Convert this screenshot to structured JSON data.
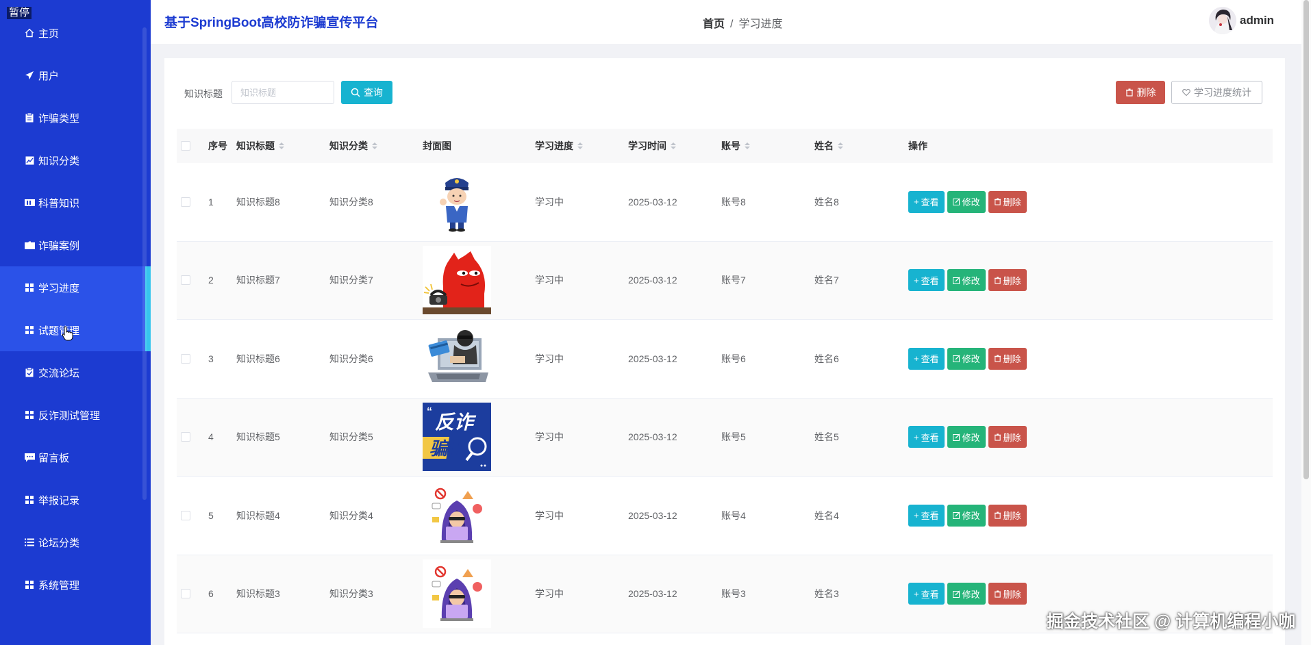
{
  "pause_label": "暂停",
  "header": {
    "title": "基于SpringBoot高校防诈骗宣传平台",
    "breadcrumb_home": "首页",
    "breadcrumb_sep": "/",
    "breadcrumb_current": "学习进度",
    "username": "admin"
  },
  "sidebar": {
    "items": [
      {
        "label": "主页",
        "icon": "home-icon"
      },
      {
        "label": "用户",
        "icon": "paper-plane-icon"
      },
      {
        "label": "诈骗类型",
        "icon": "clipboard-icon"
      },
      {
        "label": "知识分类",
        "icon": "chart-icon"
      },
      {
        "label": "科普知识",
        "icon": "book-icon"
      },
      {
        "label": "诈骗案例",
        "icon": "folder-icon"
      },
      {
        "label": "学习进度",
        "icon": "grid-icon"
      },
      {
        "label": "试题管理",
        "icon": "grid-icon"
      },
      {
        "label": "交流论坛",
        "icon": "clipboard-check-icon"
      },
      {
        "label": "反诈测试管理",
        "icon": "grid-icon"
      },
      {
        "label": "留言板",
        "icon": "message-icon"
      },
      {
        "label": "举报记录",
        "icon": "grid-icon"
      },
      {
        "label": "论坛分类",
        "icon": "list-icon"
      },
      {
        "label": "系统管理",
        "icon": "grid-icon"
      }
    ],
    "active_index": 6,
    "hover_index": 7
  },
  "filter": {
    "label": "知识标题",
    "placeholder": "知识标题",
    "search_label": "查询"
  },
  "toolbar": {
    "delete_label": "删除",
    "stats_label": "学习进度统计"
  },
  "table": {
    "columns": [
      "序号",
      "知识标题",
      "知识分类",
      "封面图",
      "学习进度",
      "学习时间",
      "账号",
      "姓名",
      "操作"
    ],
    "rows": [
      {
        "index": "1",
        "title": "知识标题8",
        "category": "知识分类8",
        "cover": "police-cover",
        "progress": "学习中",
        "time": "2025-03-12",
        "account": "账号8",
        "name": "姓名8"
      },
      {
        "index": "2",
        "title": "知识标题7",
        "category": "知识分类7",
        "cover": "red-monster-cover",
        "progress": "学习中",
        "time": "2025-03-12",
        "account": "账号7",
        "name": "姓名7"
      },
      {
        "index": "3",
        "title": "知识标题6",
        "category": "知识分类6",
        "cover": "laptop-thief-cover",
        "progress": "学习中",
        "time": "2025-03-12",
        "account": "账号6",
        "name": "姓名6"
      },
      {
        "index": "4",
        "title": "知识标题5",
        "category": "知识分类5",
        "cover": "anti-fraud-poster-cover",
        "progress": "学习中",
        "time": "2025-03-12",
        "account": "账号5",
        "name": "姓名5"
      },
      {
        "index": "5",
        "title": "知识标题4",
        "category": "知识分类4",
        "cover": "hooded-hacker-cover",
        "progress": "学习中",
        "time": "2025-03-12",
        "account": "账号4",
        "name": "姓名4"
      },
      {
        "index": "6",
        "title": "知识标题3",
        "category": "知识分类3",
        "cover": "hooded-hacker-cover",
        "progress": "学习中",
        "time": "2025-03-12",
        "account": "账号3",
        "name": "姓名3"
      }
    ],
    "actions": {
      "view": "查看",
      "edit": "修改",
      "delete": "删除"
    }
  },
  "poster_text": {
    "line1": "反诈",
    "line2": "骗!!"
  },
  "watermark": "掘金技术社区 @ 计算机编程小咖",
  "colors": {
    "sidebar": "#1c3bd1",
    "accent": "#17b3d0",
    "success": "#25b479",
    "danger": "#c9544a"
  }
}
